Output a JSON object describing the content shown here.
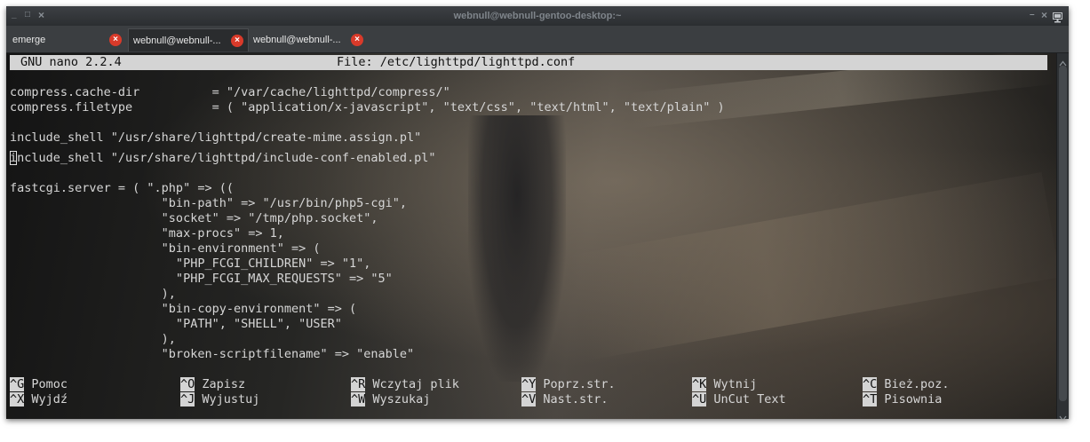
{
  "window": {
    "title": "webnull@webnull-gentoo-desktop:~",
    "minimize_glyph": "_",
    "maximize_glyph": "□",
    "close_glyph": "×",
    "tray_minimize_glyph": "–",
    "tray_close_glyph": "×",
    "tray_icon": "monitor-icon"
  },
  "tabs": [
    {
      "label": "emerge",
      "active": false
    },
    {
      "label": "webnull@webnull-...",
      "active": true
    },
    {
      "label": "webnull@webnull-...",
      "active": false
    }
  ],
  "tab_close_glyph": "×",
  "nano": {
    "version": "GNU nano 2.2.4",
    "file_label": "File: /etc/lighttpd/lighttpd.conf"
  },
  "editor_lines": [
    "",
    "compress.cache-dir          = \"/var/cache/lighttpd/compress/\"",
    "compress.filetype           = ( \"application/x-javascript\", \"text/css\", \"text/html\", \"text/plain\" )",
    "",
    "include_shell \"/usr/share/lighttpd/create-mime.assign.pl\"",
    "include_shell \"/usr/share/lighttpd/include-conf-enabled.pl\"",
    "",
    "fastcgi.server = ( \".php\" => ((",
    "                     \"bin-path\" => \"/usr/bin/php5-cgi\",",
    "                     \"socket\" => \"/tmp/php.socket\",",
    "                     \"max-procs\" => 1,",
    "                     \"bin-environment\" => (",
    "                       \"PHP_FCGI_CHILDREN\" => \"1\",",
    "                       \"PHP_FCGI_MAX_REQUESTS\" => \"5\"",
    "                     ),",
    "                     \"bin-copy-environment\" => (",
    "                       \"PATH\", \"SHELL\", \"USER\"",
    "                     ),",
    "                     \"broken-scriptfilename\" => \"enable\""
  ],
  "shortcuts_row1": [
    {
      "key": "^G",
      "label": "Pomoc"
    },
    {
      "key": "^O",
      "label": "Zapisz"
    },
    {
      "key": "^R",
      "label": "Wczytaj plik"
    },
    {
      "key": "^Y",
      "label": "Poprz.str."
    },
    {
      "key": "^K",
      "label": "Wytnij"
    },
    {
      "key": "^C",
      "label": "Bież.poz."
    }
  ],
  "shortcuts_row2": [
    {
      "key": "^X",
      "label": "Wyjdź"
    },
    {
      "key": "^J",
      "label": "Wyjustuj"
    },
    {
      "key": "^W",
      "label": "Wyszukaj"
    },
    {
      "key": "^V",
      "label": "Nast.str."
    },
    {
      "key": "^U",
      "label": "UnCut Text"
    },
    {
      "key": "^T",
      "label": "Pisownia"
    }
  ],
  "colors": {
    "nano_bar_bg": "#d4d4d4",
    "text": "#d6d6d6",
    "tab_close": "#d93a2a",
    "titlebar": "#2b2e31"
  }
}
